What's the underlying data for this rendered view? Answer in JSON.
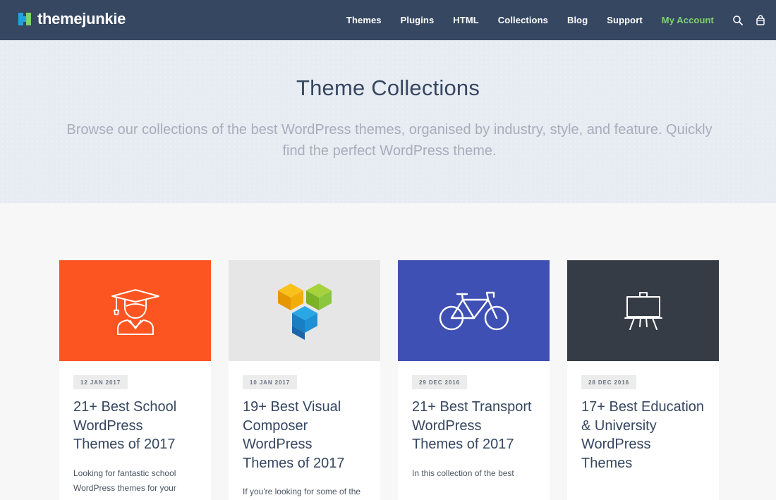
{
  "header": {
    "logo_text": "themejunkie",
    "logo_colors": {
      "blue": "#21a3e0",
      "green": "#7ed26f"
    },
    "nav": [
      {
        "label": "Themes"
      },
      {
        "label": "Plugins"
      },
      {
        "label": "HTML"
      },
      {
        "label": "Collections"
      },
      {
        "label": "Blog"
      },
      {
        "label": "Support"
      },
      {
        "label": "My Account"
      }
    ],
    "icons": [
      "search-icon",
      "cart-icon"
    ],
    "accent_color": "#7ed26f",
    "background_color": "#364761"
  },
  "hero": {
    "title": "Theme Collections",
    "subtitle": "Browse our collections of the best WordPress themes, organised by industry, style, and feature. Quickly find the perfect WordPress theme."
  },
  "cards": [
    {
      "date": "12 JAN 2017",
      "title": "21+ Best School WordPress Themes of 2017",
      "excerpt": "Looking for fantastic school WordPress themes for your",
      "icon": "graduate-icon",
      "color": "#fd5521"
    },
    {
      "date": "10 JAN 2017",
      "title": "19+ Best Visual Composer WordPress Themes of 2017",
      "excerpt": "If you're looking for some of the",
      "icon": "visual-composer-logo",
      "color": "#e6e6e6"
    },
    {
      "date": "29 DEC 2016",
      "title": "21+ Best Transport WordPress Themes of 2017",
      "excerpt": "In this collection of the best",
      "icon": "bicycle-icon",
      "color": "#3e50b4"
    },
    {
      "date": "28 DEC 2016",
      "title": "17+ Best Education & University WordPress Themes",
      "excerpt": "",
      "icon": "easel-board-icon",
      "color": "#363c46"
    }
  ]
}
